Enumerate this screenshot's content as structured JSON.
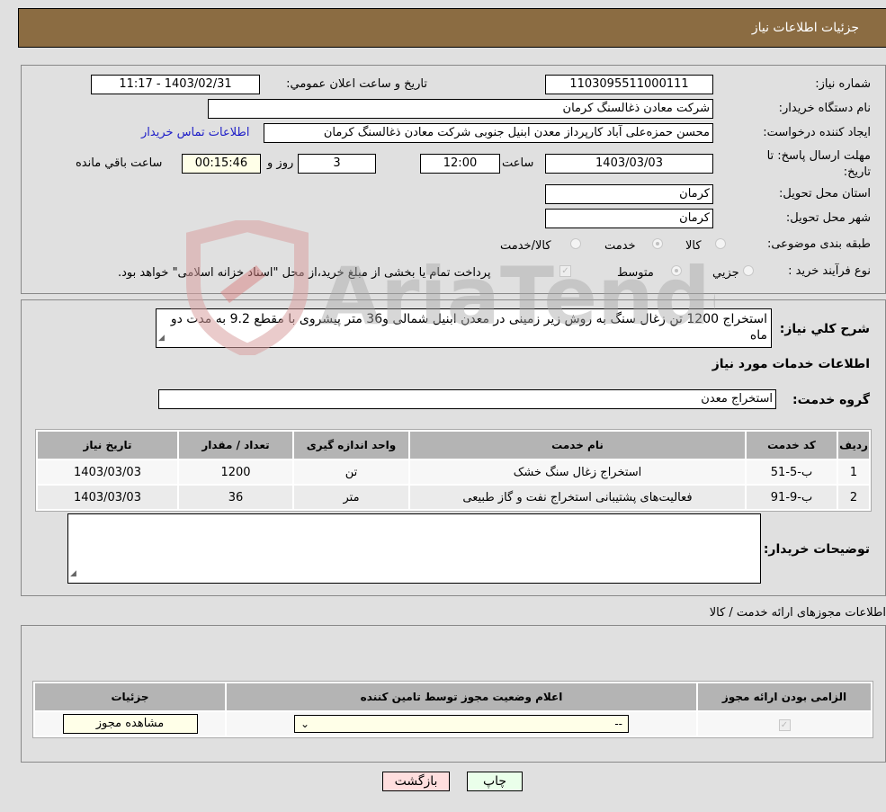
{
  "header": {
    "title": "جزئیات اطلاعات نیاز"
  },
  "form": {
    "need_number": {
      "label": "شماره نیاز:",
      "value": "1103095511000111"
    },
    "announce_datetime": {
      "label": "تاریخ و ساعت اعلان عمومي:",
      "value": "1403/02/31 - 11:17"
    },
    "buyer_org": {
      "label": "نام دستگاه خریدار:",
      "value": "شرکت معادن ذغالسنگ کرمان"
    },
    "requester": {
      "label": "ایجاد کننده درخواست:",
      "value": "محسن حمزه‌علی آباد کارپرداز معدن ابنیل جنوبی شرکت معادن ذغالسنگ کرمان"
    },
    "buyer_contact_link": "اطلاعات تماس خریدار",
    "deadline": {
      "label": "مهلت ارسال پاسخ: تا تاریخ:",
      "date": "1403/03/03",
      "time_label": "ساعت",
      "time": "12:00",
      "days": "3",
      "days_label": "روز و",
      "remaining": "00:15:46",
      "remaining_label": "ساعت باقي مانده"
    },
    "delivery_province": {
      "label": "استان محل تحویل:",
      "value": "کرمان"
    },
    "delivery_city": {
      "label": "شهر محل تحویل:",
      "value": "کرمان"
    },
    "category": {
      "label": "طبقه بندی موضوعی:",
      "options": [
        "کالا",
        "خدمت",
        "کالا/خدمت"
      ],
      "selected": "خدمت"
    },
    "purchase_type": {
      "label": "نوع فرآیند خرید :",
      "options": [
        "جزيي",
        "متوسط"
      ],
      "selected": "متوسط",
      "treasury_note": "پرداخت تمام یا بخشی از مبلغ خرید،از محل \"اسناد خزانه اسلامی\" خواهد بود.",
      "treasury_checked": true
    },
    "general_description": {
      "label": "شرح کلي نیاز:",
      "value": "استخراج 1200 تن زغال سنگ به روش زیر زمینی در معدن ابنیل شمالی و36 متر پیشروی با مقطع 9.2 به مدت دو ماه"
    },
    "services_title": "اطلاعات خدمات مورد نیاز",
    "service_group": {
      "label": "گروه خدمت:",
      "value": "استخراج معدن"
    },
    "services_table": {
      "headers": [
        "ردیف",
        "کد خدمت",
        "نام خدمت",
        "واحد اندازه گیری",
        "تعداد / مقدار",
        "تاریخ نیاز"
      ],
      "rows": [
        [
          "1",
          "ب-5-51",
          "استخراج زغال سنگ خشک",
          "تن",
          "1200",
          "1403/03/03"
        ],
        [
          "2",
          "ب-9-91",
          "فعالیت‌های پشتیبانی استخراج نفت و گاز طبیعی",
          "متر",
          "36",
          "1403/03/03"
        ]
      ]
    },
    "buyer_notes": {
      "label": "توضیحات خریدار:",
      "value": ""
    }
  },
  "permits": {
    "title": "اطلاعات مجوزهای ارائه خدمت / کالا",
    "headers": [
      "الزامی بودن ارائه مجوز",
      "اعلام وضعیت مجوز توسط تامین کننده",
      "جزئیات"
    ],
    "row": {
      "required_checked": true,
      "status_select": "--",
      "details_button": "مشاهده مجوز"
    }
  },
  "buttons": {
    "print": "چاپ",
    "back": "بازگشت"
  },
  "watermark": "AriaTender.neT",
  "colors": {
    "header": "#8b6c42",
    "link": "#2020c8",
    "print_bg": "#eaffea",
    "back_bg": "#ffdede"
  }
}
